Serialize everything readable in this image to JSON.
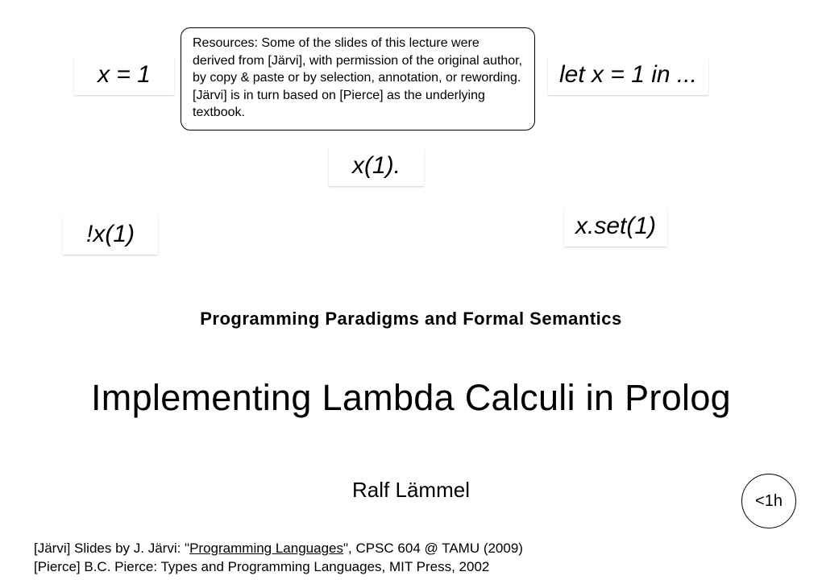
{
  "notes": {
    "x_eq_1": "x = 1",
    "let_x": "let x = 1 in ...",
    "x_call": "x(1).",
    "bang_x": "!x(1)",
    "x_set": "x.set(1)"
  },
  "resources_box": "Resources: Some of the slides of this lecture were derived from [Järvi], with permission of the original author, by copy & paste or by selection, annotation, or rewording.  [Järvi] is in turn based on [Pierce] as the underlying textbook.",
  "subtitle": "Programming Paradigms and Formal Semantics",
  "title": "Implementing Lambda Calculi in Prolog",
  "author": "Ralf Lämmel",
  "duration": "<1h",
  "refs": {
    "jarvi_pre": "[Järvi] Slides by J. Järvi: \"",
    "jarvi_link": "Programming Languages",
    "jarvi_post": "\", CPSC 604 @ TAMU (2009)",
    "pierce": "[Pierce] B.C. Pierce: Types and Programming Languages, MIT Press, 2002"
  }
}
